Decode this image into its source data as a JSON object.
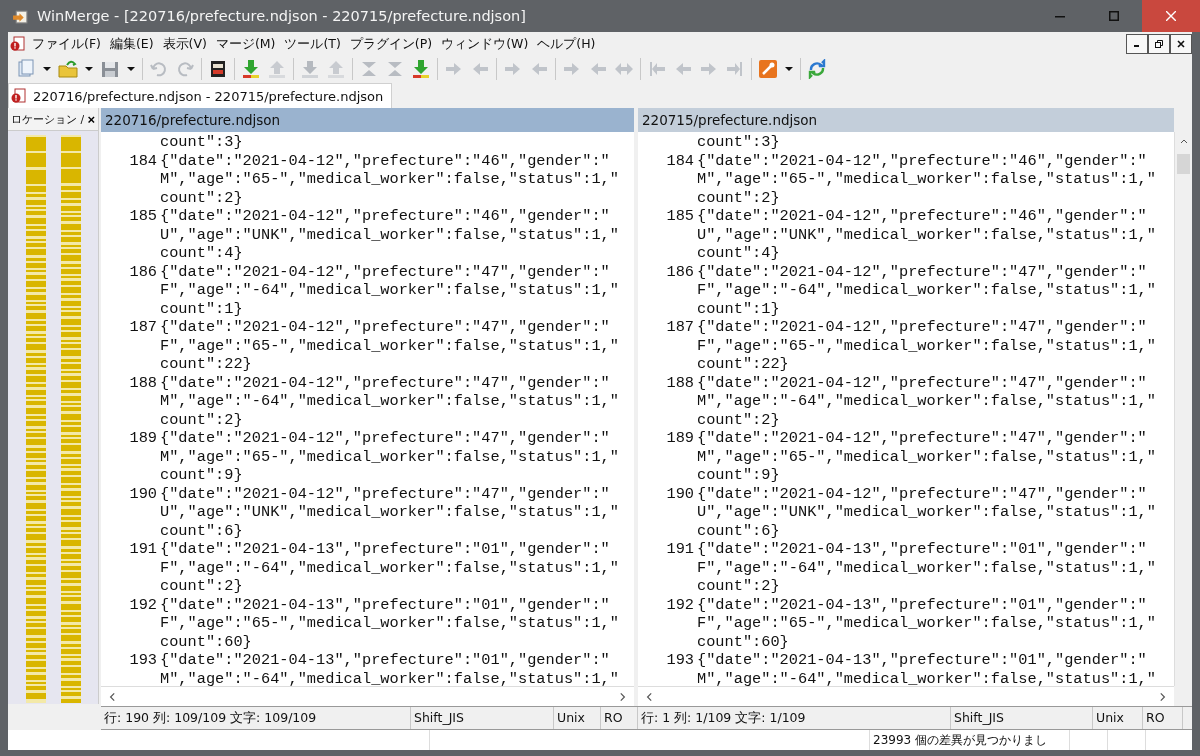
{
  "window": {
    "title": "WinMerge - [220716/prefecture.ndjson - 220715/prefecture.ndjson]"
  },
  "menu": [
    "ファイル(F)",
    "編集(E)",
    "表示(V)",
    "マージ(M)",
    "ツール(T)",
    "プラグイン(P)",
    "ウィンドウ(W)",
    "ヘルプ(H)"
  ],
  "document_tab": {
    "label": "220716/prefecture.ndjson - 220715/prefecture.ndjson",
    "selected": true
  },
  "location_pane": {
    "title": "ロケーション /",
    "close": "×"
  },
  "panes": [
    {
      "header": "220716/prefecture.ndjson",
      "active": true,
      "lines": [
        {
          "text": "count\":3}"
        },
        {
          "number": "184",
          "text": "{\"date\":\"2021-04-12\",\"prefecture\":\"46\",\"gender\":\""
        },
        {
          "text": "M\",\"age\":\"65-\",\"medical_worker\":false,\"status\":1,\""
        },
        {
          "text": "count\":2}"
        },
        {
          "number": "185",
          "text": "{\"date\":\"2021-04-12\",\"prefecture\":\"46\",\"gender\":\""
        },
        {
          "text": "U\",\"age\":\"UNK\",\"medical_worker\":false,\"status\":1,\""
        },
        {
          "text": "count\":4}"
        },
        {
          "number": "186",
          "text": "{\"date\":\"2021-04-12\",\"prefecture\":\"47\",\"gender\":\""
        },
        {
          "text": "F\",\"age\":\"-64\",\"medical_worker\":false,\"status\":1,\""
        },
        {
          "text": "count\":1}"
        },
        {
          "number": "187",
          "text": "{\"date\":\"2021-04-12\",\"prefecture\":\"47\",\"gender\":\""
        },
        {
          "text": "F\",\"age\":\"65-\",\"medical_worker\":false,\"status\":1,\""
        },
        {
          "text": "count\":22}"
        },
        {
          "number": "188",
          "text": "{\"date\":\"2021-04-12\",\"prefecture\":\"47\",\"gender\":\""
        },
        {
          "text": "M\",\"age\":\"-64\",\"medical_worker\":false,\"status\":1,\""
        },
        {
          "text": "count\":2}"
        },
        {
          "number": "189",
          "text": "{\"date\":\"2021-04-12\",\"prefecture\":\"47\",\"gender\":\""
        },
        {
          "text": "M\",\"age\":\"65-\",\"medical_worker\":false,\"status\":1,\""
        },
        {
          "text": "count\":9}"
        },
        {
          "number": "190",
          "text": "{\"date\":\"2021-04-12\",\"prefecture\":\"47\",\"gender\":\""
        },
        {
          "text": "U\",\"age\":\"UNK\",\"medical_worker\":false,\"status\":1,\""
        },
        {
          "text": "count\":6}"
        },
        {
          "number": "191",
          "text": "{\"date\":\"2021-04-13\",\"prefecture\":\"01\",\"gender\":\""
        },
        {
          "text": "F\",\"age\":\"-64\",\"medical_worker\":false,\"status\":1,\""
        },
        {
          "text": "count\":2}"
        },
        {
          "number": "192",
          "text": "{\"date\":\"2021-04-13\",\"prefecture\":\"01\",\"gender\":\""
        },
        {
          "text": "F\",\"age\":\"65-\",\"medical_worker\":false,\"status\":1,\""
        },
        {
          "text": "count\":60}"
        },
        {
          "number": "193",
          "text": "{\"date\":\"2021-04-13\",\"prefecture\":\"01\",\"gender\":\""
        },
        {
          "text": "M\",\"age\":\"-64\",\"medical_worker\":false,\"status\":1,\""
        }
      ],
      "status": {
        "position": "行: 190  列: 109/109  文字: 109/109",
        "encoding": "Shift_JIS",
        "eol": "Unix",
        "mode": "RO"
      }
    },
    {
      "header": "220715/prefecture.ndjson",
      "active": false,
      "lines": [
        {
          "text": "count\":3}"
        },
        {
          "number": "184",
          "text": "{\"date\":\"2021-04-12\",\"prefecture\":\"46\",\"gender\":\""
        },
        {
          "text": "M\",\"age\":\"65-\",\"medical_worker\":false,\"status\":1,\""
        },
        {
          "text": "count\":2}"
        },
        {
          "number": "185",
          "text": "{\"date\":\"2021-04-12\",\"prefecture\":\"46\",\"gender\":\""
        },
        {
          "text": "U\",\"age\":\"UNK\",\"medical_worker\":false,\"status\":1,\""
        },
        {
          "text": "count\":4}"
        },
        {
          "number": "186",
          "text": "{\"date\":\"2021-04-12\",\"prefecture\":\"47\",\"gender\":\""
        },
        {
          "text": "F\",\"age\":\"-64\",\"medical_worker\":false,\"status\":1,\""
        },
        {
          "text": "count\":1}"
        },
        {
          "number": "187",
          "text": "{\"date\":\"2021-04-12\",\"prefecture\":\"47\",\"gender\":\""
        },
        {
          "text": "F\",\"age\":\"65-\",\"medical_worker\":false,\"status\":1,\""
        },
        {
          "text": "count\":22}"
        },
        {
          "number": "188",
          "text": "{\"date\":\"2021-04-12\",\"prefecture\":\"47\",\"gender\":\""
        },
        {
          "text": "M\",\"age\":\"-64\",\"medical_worker\":false,\"status\":1,\""
        },
        {
          "text": "count\":2}"
        },
        {
          "number": "189",
          "text": "{\"date\":\"2021-04-12\",\"prefecture\":\"47\",\"gender\":\""
        },
        {
          "text": "M\",\"age\":\"65-\",\"medical_worker\":false,\"status\":1,\""
        },
        {
          "text": "count\":9}"
        },
        {
          "number": "190",
          "text": "{\"date\":\"2021-04-12\",\"prefecture\":\"47\",\"gender\":\""
        },
        {
          "text": "U\",\"age\":\"UNK\",\"medical_worker\":false,\"status\":1,\""
        },
        {
          "text": "count\":6}"
        },
        {
          "number": "191",
          "text": "{\"date\":\"2021-04-13\",\"prefecture\":\"01\",\"gender\":\""
        },
        {
          "text": "F\",\"age\":\"-64\",\"medical_worker\":false,\"status\":1,\""
        },
        {
          "text": "count\":2}"
        },
        {
          "number": "192",
          "text": "{\"date\":\"2021-04-13\",\"prefecture\":\"01\",\"gender\":\""
        },
        {
          "text": "F\",\"age\":\"65-\",\"medical_worker\":false,\"status\":1,\""
        },
        {
          "text": "count\":60}"
        },
        {
          "number": "193",
          "text": "{\"date\":\"2021-04-13\",\"prefecture\":\"01\",\"gender\":\""
        },
        {
          "text": "M\",\"age\":\"-64\",\"medical_worker\":false,\"status\":1,\""
        }
      ],
      "status": {
        "position": "行: 1  列: 1/109  文字: 1/109",
        "encoding": "Shift_JIS",
        "eol": "Unix",
        "mode": "RO"
      }
    }
  ],
  "status_bar": {
    "message": "23993 個の差異が見つかりまし"
  }
}
